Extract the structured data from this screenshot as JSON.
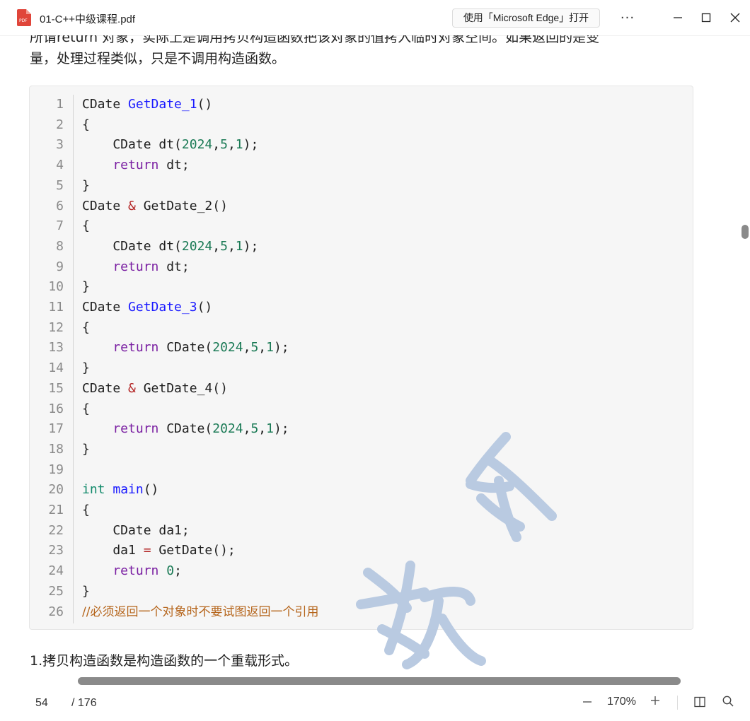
{
  "window": {
    "title": "01-C++中级课程.pdf",
    "open_in_edge": "使用「Microsoft Edge」打开",
    "more": "···"
  },
  "document": {
    "para_top": "所谓return 对象，实际上是调用拷贝构造函数把该对象的值拷入临时对象空间。如果返回的是变",
    "para_2": "量，处理过程类似，只是不调用构造函数。",
    "para_bottom": "1.拷贝构造函数是构造函数的一个重载形式。",
    "code_lines": [
      {
        "n": "1",
        "tokens": [
          [
            "plain",
            "CDate "
          ],
          [
            "fn",
            "GetDate_1"
          ],
          [
            "plain",
            "()"
          ]
        ]
      },
      {
        "n": "2",
        "tokens": [
          [
            "plain",
            "{"
          ]
        ]
      },
      {
        "n": "3",
        "tokens": [
          [
            "plain",
            "    CDate dt("
          ],
          [
            "num",
            "2024"
          ],
          [
            "plain",
            ","
          ],
          [
            "num",
            "5"
          ],
          [
            "plain",
            ","
          ],
          [
            "num",
            "1"
          ],
          [
            "plain",
            ");"
          ]
        ]
      },
      {
        "n": "4",
        "tokens": [
          [
            "kw",
            "    return"
          ],
          [
            "plain",
            " dt;"
          ]
        ]
      },
      {
        "n": "5",
        "tokens": [
          [
            "plain",
            "}"
          ]
        ]
      },
      {
        "n": "6",
        "tokens": [
          [
            "plain",
            "CDate "
          ],
          [
            "op",
            "&"
          ],
          [
            "plain",
            " GetDate_2()"
          ]
        ]
      },
      {
        "n": "7",
        "tokens": [
          [
            "plain",
            "{"
          ]
        ]
      },
      {
        "n": "8",
        "tokens": [
          [
            "plain",
            "    CDate dt("
          ],
          [
            "num",
            "2024"
          ],
          [
            "plain",
            ","
          ],
          [
            "num",
            "5"
          ],
          [
            "plain",
            ","
          ],
          [
            "num",
            "1"
          ],
          [
            "plain",
            ");"
          ]
        ]
      },
      {
        "n": "9",
        "tokens": [
          [
            "kw",
            "    return"
          ],
          [
            "plain",
            " dt;"
          ]
        ]
      },
      {
        "n": "10",
        "tokens": [
          [
            "plain",
            "}"
          ]
        ]
      },
      {
        "n": "11",
        "tokens": [
          [
            "plain",
            "CDate "
          ],
          [
            "fn",
            "GetDate_3"
          ],
          [
            "plain",
            "()"
          ]
        ]
      },
      {
        "n": "12",
        "tokens": [
          [
            "plain",
            "{"
          ]
        ]
      },
      {
        "n": "13",
        "tokens": [
          [
            "kw",
            "    return"
          ],
          [
            "plain",
            " CDate("
          ],
          [
            "num",
            "2024"
          ],
          [
            "plain",
            ","
          ],
          [
            "num",
            "5"
          ],
          [
            "plain",
            ","
          ],
          [
            "num",
            "1"
          ],
          [
            "plain",
            ");"
          ]
        ]
      },
      {
        "n": "14",
        "tokens": [
          [
            "plain",
            "}"
          ]
        ]
      },
      {
        "n": "15",
        "tokens": [
          [
            "plain",
            "CDate "
          ],
          [
            "op",
            "&"
          ],
          [
            "plain",
            " GetDate_4()"
          ]
        ]
      },
      {
        "n": "16",
        "tokens": [
          [
            "plain",
            "{"
          ]
        ]
      },
      {
        "n": "17",
        "tokens": [
          [
            "kw",
            "    return"
          ],
          [
            "plain",
            " CDate("
          ],
          [
            "num",
            "2024"
          ],
          [
            "plain",
            ","
          ],
          [
            "num",
            "5"
          ],
          [
            "plain",
            ","
          ],
          [
            "num",
            "1"
          ],
          [
            "plain",
            ");"
          ]
        ]
      },
      {
        "n": "18",
        "tokens": [
          [
            "plain",
            "}"
          ]
        ]
      },
      {
        "n": "19",
        "tokens": []
      },
      {
        "n": "20",
        "tokens": [
          [
            "type",
            "int "
          ],
          [
            "fn",
            "main"
          ],
          [
            "plain",
            "()"
          ]
        ]
      },
      {
        "n": "21",
        "tokens": [
          [
            "plain",
            "{"
          ]
        ]
      },
      {
        "n": "22",
        "tokens": [
          [
            "plain",
            "    CDate da1;"
          ]
        ]
      },
      {
        "n": "23",
        "tokens": [
          [
            "plain",
            "    da1 "
          ],
          [
            "op",
            "="
          ],
          [
            "plain",
            " GetDate();"
          ]
        ]
      },
      {
        "n": "24",
        "tokens": [
          [
            "kw",
            "    return"
          ],
          [
            "plain",
            " "
          ],
          [
            "num",
            "0"
          ],
          [
            "plain",
            ";"
          ]
        ]
      },
      {
        "n": "25",
        "tokens": [
          [
            "plain",
            "}"
          ]
        ]
      },
      {
        "n": "26",
        "tokens": [
          [
            "cm",
            "//必须返回一个对象时不要试图返回一个引用"
          ]
        ]
      }
    ]
  },
  "statusbar": {
    "page": "54",
    "total": "/ 176",
    "zoom": "170%"
  },
  "colors": {
    "keyword": "#7a1fa2",
    "function": "#1a1aff",
    "number": "#1a7a55",
    "operator": "#b22222",
    "comment": "#b5641a",
    "watermark": "#b6c8e0"
  }
}
